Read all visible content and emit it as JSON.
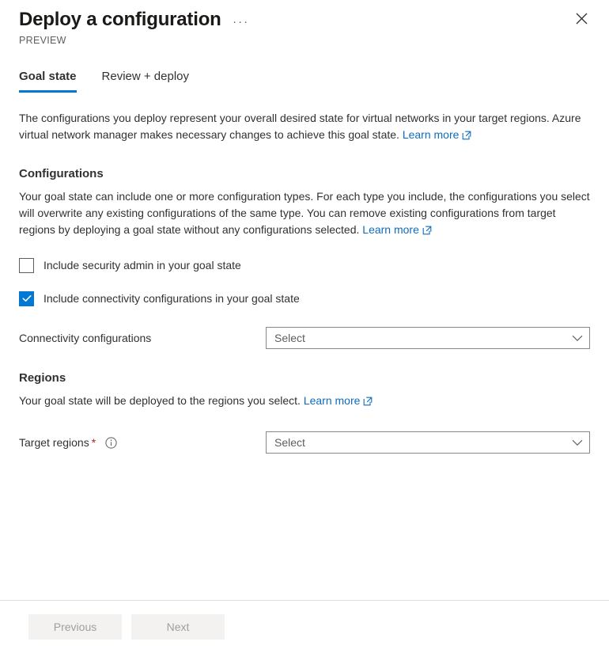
{
  "header": {
    "title": "Deploy a configuration",
    "preview_label": "PREVIEW",
    "ellipsis_label": "···",
    "more_icon": "more-horizontal-icon",
    "close_icon": "close-icon"
  },
  "tabs": [
    {
      "label": "Goal state",
      "active": true
    },
    {
      "label": "Review + deploy",
      "active": false
    }
  ],
  "intro": {
    "text_before_link": "The configurations you deploy represent your overall desired state for virtual networks in your target regions. Azure virtual network manager makes necessary changes to achieve this goal state. ",
    "link_label": "Learn more"
  },
  "configurations": {
    "heading": "Configurations",
    "description_before_link": "Your goal state can include one or more configuration types. For each type you include, the configurations you select will overwrite any existing configurations of the same type. You can remove existing configurations from target regions by deploying a goal state without any configurations selected. ",
    "link_label": "Learn more",
    "checkboxes": [
      {
        "label": "Include security admin in your goal state",
        "checked": false
      },
      {
        "label": "Include connectivity configurations in your goal state",
        "checked": true
      }
    ],
    "connectivity_field": {
      "label": "Connectivity configurations",
      "placeholder": "Select",
      "value": "Select",
      "chevron_icon": "chevron-down-icon"
    }
  },
  "regions": {
    "heading": "Regions",
    "description_before_link": "Your goal state will be deployed to the regions you select. ",
    "link_label": "Learn more",
    "target_field": {
      "label": "Target regions",
      "required_marker": "*",
      "info_icon": "info-circle-icon",
      "placeholder": "Select",
      "value": "Select",
      "chevron_icon": "chevron-down-icon"
    }
  },
  "footer": {
    "previous_label": "Previous",
    "next_label": "Next"
  },
  "colors": {
    "accent": "#0078d4",
    "link": "#0f6cbd",
    "required": "#a4262c",
    "text": "#323130",
    "muted": "#605e5c"
  }
}
